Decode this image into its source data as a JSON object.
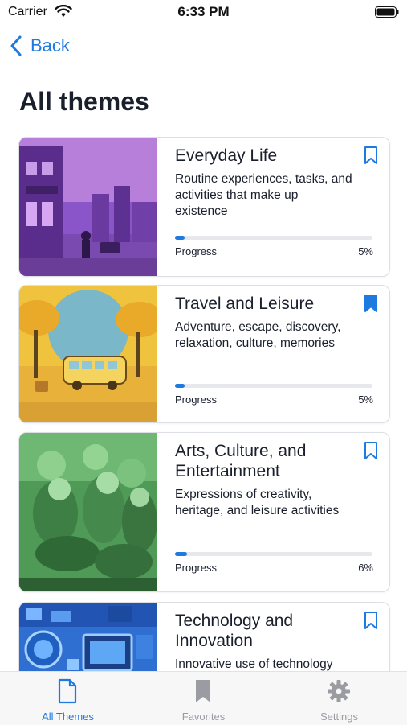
{
  "status_bar": {
    "carrier": "Carrier",
    "time": "6:33 PM"
  },
  "nav": {
    "back_label": "Back"
  },
  "page": {
    "title": "All themes"
  },
  "colors": {
    "accent": "#1f7ae0",
    "inactive": "#9a9ca1"
  },
  "themes": [
    {
      "title": "Everyday Life",
      "description": "Routine experiences, tasks, and activities that make up existence",
      "progress_label": "Progress",
      "progress_text": "5%",
      "progress": 0.05,
      "bookmarked": false,
      "image": "purple-street-illustration"
    },
    {
      "title": "Travel and Leisure",
      "description": "Adventure, escape, discovery, relaxation, culture, memories",
      "progress_label": "Progress",
      "progress_text": "5%",
      "progress": 0.05,
      "bookmarked": true,
      "image": "yellow-bus-illustration"
    },
    {
      "title": "Arts, Culture, and Entertainment",
      "description": "Expressions of creativity, heritage, and leisure activities",
      "progress_label": "Progress",
      "progress_text": "6%",
      "progress": 0.06,
      "bookmarked": false,
      "image": "green-performers-illustration"
    },
    {
      "title": "Technology and Innovation",
      "description": "Innovative use of technology",
      "bookmarked": false,
      "image": "blue-tech-illustration"
    }
  ],
  "tab_bar": {
    "tabs": [
      {
        "label": "All Themes",
        "icon": "document-icon",
        "active": true
      },
      {
        "label": "Favorites",
        "icon": "bookmark-icon",
        "active": false
      },
      {
        "label": "Settings",
        "icon": "gear-icon",
        "active": false
      }
    ]
  }
}
